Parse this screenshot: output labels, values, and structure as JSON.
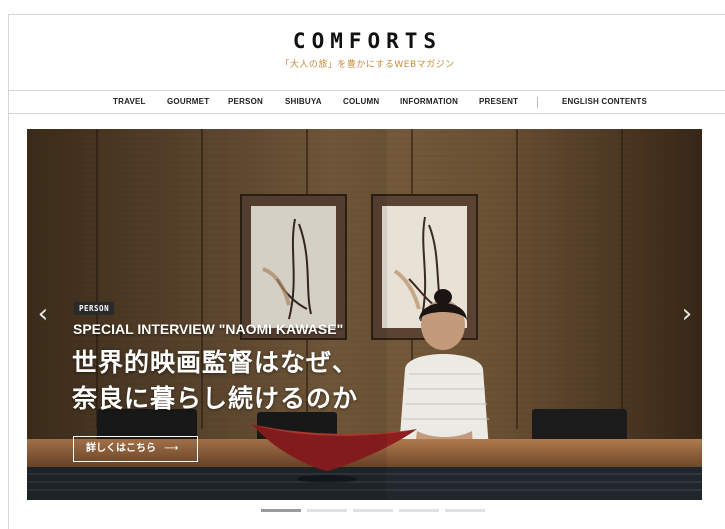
{
  "header": {
    "logo": "COMFORTS",
    "tagline": "「大人の旅」を豊かにするWEBマガジン"
  },
  "nav": {
    "items": [
      "TRAVEL",
      "GOURMET",
      "PERSON",
      "SHIBUYA",
      "COLUMN",
      "INFORMATION",
      "PRESENT",
      "ENGLISH CONTENTS"
    ]
  },
  "hero": {
    "category": "PERSON",
    "subtitle": "SPECIAL INTERVIEW \"NAOMI KAWASE\"",
    "title_line1": "世界的映画監督はなぜ、",
    "title_line2": "奈良に暮らし続けるのか",
    "cta": "詳しくはこちら",
    "cta_arrow": "⟶",
    "prev": "‹",
    "next": "›",
    "slides_total": 5,
    "active_slide": 1
  },
  "colors": {
    "tagline": "#c78a3a",
    "accent_dark": "#2a2a2a"
  }
}
